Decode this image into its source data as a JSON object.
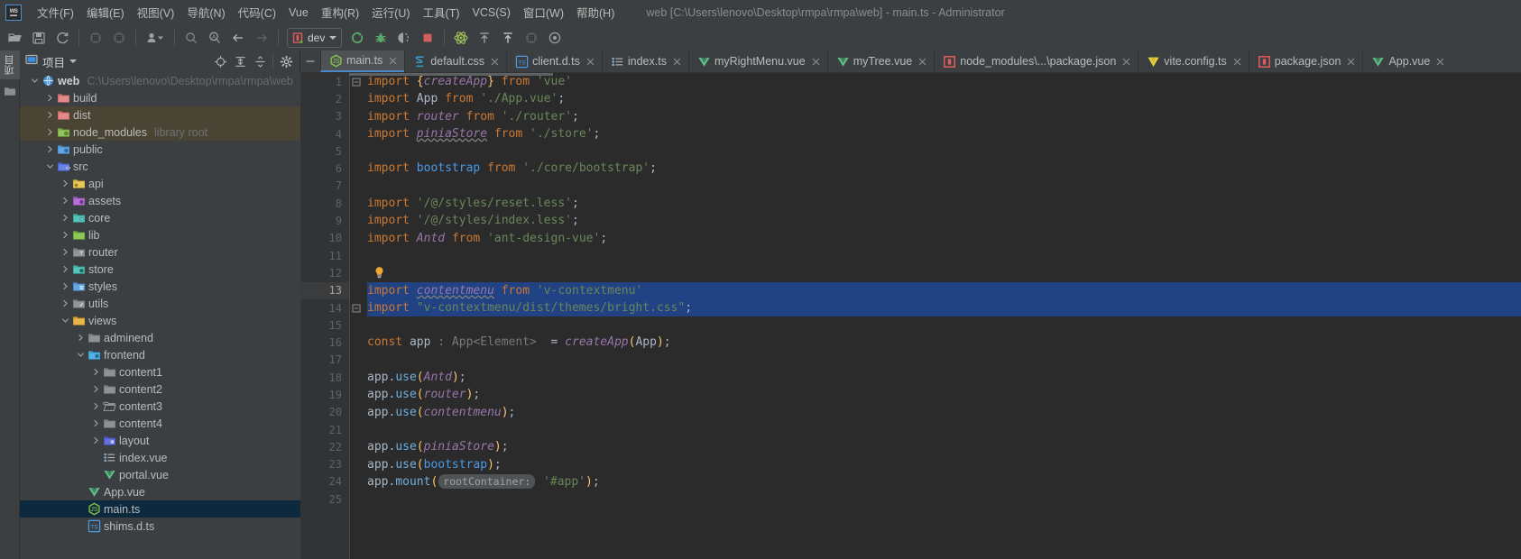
{
  "window": {
    "title": "web [C:\\Users\\lenovo\\Desktop\\rmpa\\rmpa\\web] - main.ts - Administrator",
    "logo_text": "WS"
  },
  "menubar": {
    "items": [
      {
        "label": "文件(F)",
        "name": "menu-file"
      },
      {
        "label": "编辑(E)",
        "name": "menu-edit"
      },
      {
        "label": "视图(V)",
        "name": "menu-view"
      },
      {
        "label": "导航(N)",
        "name": "menu-navigate"
      },
      {
        "label": "代码(C)",
        "name": "menu-code"
      },
      {
        "label": "Vue",
        "name": "menu-vue"
      },
      {
        "label": "重构(R)",
        "name": "menu-refactor"
      },
      {
        "label": "运行(U)",
        "name": "menu-run"
      },
      {
        "label": "工具(T)",
        "name": "menu-tools"
      },
      {
        "label": "VCS(S)",
        "name": "menu-vcs"
      },
      {
        "label": "窗口(W)",
        "name": "menu-window"
      },
      {
        "label": "帮助(H)",
        "name": "menu-help"
      }
    ]
  },
  "toolbar": {
    "run_config_label": "dev",
    "icons": [
      "open-folder-icon",
      "save-all-icon",
      "sync-refresh-icon",
      "separator",
      "grid-icon",
      "grid-icon-2",
      "separator",
      "user-dropdown-icon",
      "separator",
      "search-icon",
      "search-everywhere-icon",
      "back-arrow-icon",
      "forward-arrow-icon",
      "separator",
      "run-config-selector",
      "run-icon",
      "debug-icon",
      "coverage-icon",
      "stop-icon",
      "separator",
      "atom-icon",
      "update-project-icon",
      "commit-icon",
      "grid-icon-3",
      "settings-gear-icon"
    ]
  },
  "toolstrip": {
    "project_tab_label": "项目",
    "folder_icon": "folder-icon"
  },
  "project_panel": {
    "title": "项目",
    "header_buttons": [
      {
        "name": "locate-file-icon"
      },
      {
        "name": "expand-all-icon"
      },
      {
        "name": "collapse-all-icon"
      },
      {
        "name": "panel-settings-gear-icon"
      }
    ],
    "tree": [
      {
        "label": "web",
        "sub": "C:\\Users\\lenovo\\Desktop\\rmpa\\rmpa\\web",
        "indent": 0,
        "arrow": "down",
        "icon": "module-root-icon",
        "state": "normal",
        "bold": true
      },
      {
        "label": "build",
        "sub": "",
        "indent": 1,
        "arrow": "right",
        "icon": "folder-red-icon",
        "state": "normal"
      },
      {
        "label": "dist",
        "sub": "",
        "indent": 1,
        "arrow": "right",
        "icon": "folder-red-icon",
        "state": "hover"
      },
      {
        "label": "node_modules",
        "sub": "library root",
        "indent": 1,
        "arrow": "right",
        "icon": "folder-green-icon",
        "state": "hover"
      },
      {
        "label": "public",
        "sub": "",
        "indent": 1,
        "arrow": "right",
        "icon": "folder-blue-icon",
        "state": "normal"
      },
      {
        "label": "src",
        "sub": "",
        "indent": 1,
        "arrow": "down",
        "icon": "folder-source-icon",
        "state": "normal"
      },
      {
        "label": "api",
        "sub": "",
        "indent": 2,
        "arrow": "right",
        "icon": "folder-yellow-icon",
        "state": "normal"
      },
      {
        "label": "assets",
        "sub": "",
        "indent": 2,
        "arrow": "right",
        "icon": "folder-purple-icon",
        "state": "normal"
      },
      {
        "label": "core",
        "sub": "",
        "indent": 2,
        "arrow": "right",
        "icon": "folder-teal-icon",
        "state": "normal"
      },
      {
        "label": "lib",
        "sub": "",
        "indent": 2,
        "arrow": "right",
        "icon": "folder-lime-icon",
        "state": "normal"
      },
      {
        "label": "router",
        "sub": "",
        "indent": 2,
        "arrow": "right",
        "icon": "folder-grey-icon",
        "state": "normal"
      },
      {
        "label": "store",
        "sub": "",
        "indent": 2,
        "arrow": "right",
        "icon": "folder-teal2-icon",
        "state": "normal"
      },
      {
        "label": "styles",
        "sub": "",
        "indent": 2,
        "arrow": "right",
        "icon": "folder-blue2-icon",
        "state": "normal"
      },
      {
        "label": "utils",
        "sub": "",
        "indent": 2,
        "arrow": "right",
        "icon": "folder-grey2-icon",
        "state": "normal"
      },
      {
        "label": "views",
        "sub": "",
        "indent": 2,
        "arrow": "down",
        "icon": "folder-orange-icon",
        "state": "normal"
      },
      {
        "label": "adminend",
        "sub": "",
        "indent": 3,
        "arrow": "right",
        "icon": "folder-plain-icon",
        "state": "normal"
      },
      {
        "label": "frontend",
        "sub": "",
        "indent": 3,
        "arrow": "down",
        "icon": "folder-cyan-icon",
        "state": "normal"
      },
      {
        "label": "content1",
        "sub": "",
        "indent": 4,
        "arrow": "right",
        "icon": "folder-plain-icon",
        "state": "normal"
      },
      {
        "label": "content2",
        "sub": "",
        "indent": 4,
        "arrow": "right",
        "icon": "folder-plain-icon",
        "state": "normal"
      },
      {
        "label": "content3",
        "sub": "",
        "indent": 4,
        "arrow": "right",
        "icon": "folder-open-icon",
        "state": "normal"
      },
      {
        "label": "content4",
        "sub": "",
        "indent": 4,
        "arrow": "right",
        "icon": "folder-plain-icon",
        "state": "normal"
      },
      {
        "label": "layout",
        "sub": "",
        "indent": 4,
        "arrow": "right",
        "icon": "folder-indigo-icon",
        "state": "normal"
      },
      {
        "label": "index.vue",
        "sub": "",
        "indent": 4,
        "arrow": "none",
        "icon": "list-file-icon",
        "state": "normal"
      },
      {
        "label": "portal.vue",
        "sub": "",
        "indent": 4,
        "arrow": "none",
        "icon": "vue-file-icon",
        "state": "normal"
      },
      {
        "label": "App.vue",
        "sub": "",
        "indent": 3,
        "arrow": "none",
        "icon": "vue-file-icon",
        "state": "normal"
      },
      {
        "label": "main.ts",
        "sub": "",
        "indent": 3,
        "arrow": "none",
        "icon": "node-js-file-icon",
        "state": "selected"
      },
      {
        "label": "shims.d.ts",
        "sub": "",
        "indent": 3,
        "arrow": "none",
        "icon": "ts-file-icon",
        "state": "normal"
      }
    ]
  },
  "editor": {
    "tabs": [
      {
        "label": "main.ts",
        "icon": "node-js-file-icon",
        "active": true
      },
      {
        "label": "default.css",
        "icon": "css-file-icon",
        "active": false
      },
      {
        "label": "client.d.ts",
        "icon": "ts-file-icon",
        "active": false
      },
      {
        "label": "index.ts",
        "icon": "list-file-icon",
        "active": false
      },
      {
        "label": "myRightMenu.vue",
        "icon": "vue-file-icon",
        "active": false
      },
      {
        "label": "myTree.vue",
        "icon": "vue-file-icon",
        "active": false
      },
      {
        "label": "node_modules\\...\\package.json",
        "icon": "json-file-icon",
        "active": false
      },
      {
        "label": "vite.config.ts",
        "icon": "vite-file-icon",
        "active": false
      },
      {
        "label": "package.json",
        "icon": "json-file-icon",
        "active": false
      },
      {
        "label": "App.vue",
        "icon": "vue-file-icon",
        "active": false
      }
    ],
    "current_line": 13,
    "selected_lines": [
      13,
      14
    ],
    "lines": [
      {
        "n": 1,
        "fold": "collapse",
        "tokens": [
          {
            "t": "import ",
            "c": "kw"
          },
          {
            "t": "{",
            "c": "fn"
          },
          {
            "t": "createApp",
            "c": "ital"
          },
          {
            "t": "}",
            "c": "fn"
          },
          {
            "t": " ",
            "c": "pun"
          },
          {
            "t": "from",
            "c": "kw"
          },
          {
            "t": " ",
            "c": "pun"
          },
          {
            "t": "'vue'",
            "c": "str"
          }
        ]
      },
      {
        "n": 2,
        "fold": "",
        "tokens": [
          {
            "t": "import ",
            "c": "kw"
          },
          {
            "t": "App",
            "c": "cls"
          },
          {
            "t": " ",
            "c": "pun"
          },
          {
            "t": "from",
            "c": "kw"
          },
          {
            "t": " ",
            "c": "pun"
          },
          {
            "t": "'./App.vue'",
            "c": "str"
          },
          {
            "t": ";",
            "c": "pun"
          }
        ]
      },
      {
        "n": 3,
        "fold": "",
        "tokens": [
          {
            "t": "import ",
            "c": "kw"
          },
          {
            "t": "router",
            "c": "ital"
          },
          {
            "t": " ",
            "c": "pun"
          },
          {
            "t": "from",
            "c": "kw"
          },
          {
            "t": " ",
            "c": "pun"
          },
          {
            "t": "'./router'",
            "c": "str"
          },
          {
            "t": ";",
            "c": "pun"
          }
        ]
      },
      {
        "n": 4,
        "fold": "",
        "tokens": [
          {
            "t": "import ",
            "c": "kw"
          },
          {
            "t": "piniaStore",
            "c": "ital squig"
          },
          {
            "t": " ",
            "c": "pun"
          },
          {
            "t": "from",
            "c": "kw"
          },
          {
            "t": " ",
            "c": "pun"
          },
          {
            "t": "'./store'",
            "c": "str"
          },
          {
            "t": ";",
            "c": "pun"
          }
        ]
      },
      {
        "n": 5,
        "fold": "",
        "tokens": []
      },
      {
        "n": 6,
        "fold": "",
        "tokens": [
          {
            "t": "import ",
            "c": "kw"
          },
          {
            "t": "bootstrap",
            "c": "blue"
          },
          {
            "t": " ",
            "c": "pun"
          },
          {
            "t": "from",
            "c": "kw"
          },
          {
            "t": " ",
            "c": "pun"
          },
          {
            "t": "'./core/bootstrap'",
            "c": "str"
          },
          {
            "t": ";",
            "c": "pun"
          }
        ]
      },
      {
        "n": 7,
        "fold": "",
        "tokens": []
      },
      {
        "n": 8,
        "fold": "",
        "tokens": [
          {
            "t": "import ",
            "c": "kw"
          },
          {
            "t": "'/@/styles/reset.less'",
            "c": "str"
          },
          {
            "t": ";",
            "c": "pun"
          }
        ]
      },
      {
        "n": 9,
        "fold": "",
        "tokens": [
          {
            "t": "import ",
            "c": "kw"
          },
          {
            "t": "'/@/styles/index.less'",
            "c": "str"
          },
          {
            "t": ";",
            "c": "pun"
          }
        ]
      },
      {
        "n": 10,
        "fold": "",
        "tokens": [
          {
            "t": "import ",
            "c": "kw"
          },
          {
            "t": "Antd",
            "c": "ital"
          },
          {
            "t": " ",
            "c": "pun"
          },
          {
            "t": "from",
            "c": "kw"
          },
          {
            "t": " ",
            "c": "pun"
          },
          {
            "t": "'ant-design-vue'",
            "c": "str"
          },
          {
            "t": ";",
            "c": "pun"
          }
        ]
      },
      {
        "n": 11,
        "fold": "",
        "tokens": []
      },
      {
        "n": 12,
        "fold": "",
        "tokens": [],
        "bulb": true
      },
      {
        "n": 13,
        "fold": "",
        "selected": true,
        "tokens": [
          {
            "t": "import ",
            "c": "kw"
          },
          {
            "t": "contentmenu",
            "c": "ital squig"
          },
          {
            "t": " ",
            "c": "pun"
          },
          {
            "t": "from",
            "c": "kw"
          },
          {
            "t": " ",
            "c": "pun"
          },
          {
            "t": "'v-contextmenu'",
            "c": "str"
          }
        ]
      },
      {
        "n": 14,
        "fold": "collapse",
        "selected": true,
        "tokens": [
          {
            "t": "import ",
            "c": "kw"
          },
          {
            "t": "\"v-contextmenu/dist/themes/bright.css\"",
            "c": "str"
          },
          {
            "t": ";",
            "c": "pun"
          }
        ]
      },
      {
        "n": 15,
        "fold": "",
        "tokens": []
      },
      {
        "n": 16,
        "fold": "",
        "tokens": [
          {
            "t": "const ",
            "c": "kw"
          },
          {
            "t": "app",
            "c": "cls"
          },
          {
            "t": " : App<Element>  ",
            "c": "hint"
          },
          {
            "t": "= ",
            "c": "pun"
          },
          {
            "t": "createApp",
            "c": "ital"
          },
          {
            "t": "(",
            "c": "fn"
          },
          {
            "t": "App",
            "c": "cls"
          },
          {
            "t": ")",
            "c": "fn"
          },
          {
            "t": ";",
            "c": "pun"
          }
        ]
      },
      {
        "n": 17,
        "fold": "",
        "tokens": []
      },
      {
        "n": 18,
        "fold": "",
        "tokens": [
          {
            "t": "app",
            "c": "cls"
          },
          {
            "t": ".",
            "c": "pun"
          },
          {
            "t": "use",
            "c": "meth"
          },
          {
            "t": "(",
            "c": "fn"
          },
          {
            "t": "Antd",
            "c": "ital"
          },
          {
            "t": ")",
            "c": "fn"
          },
          {
            "t": ";",
            "c": "pun"
          }
        ]
      },
      {
        "n": 19,
        "fold": "",
        "tokens": [
          {
            "t": "app",
            "c": "cls"
          },
          {
            "t": ".",
            "c": "pun"
          },
          {
            "t": "use",
            "c": "meth"
          },
          {
            "t": "(",
            "c": "fn"
          },
          {
            "t": "router",
            "c": "ital"
          },
          {
            "t": ")",
            "c": "fn"
          },
          {
            "t": ";",
            "c": "pun"
          }
        ]
      },
      {
        "n": 20,
        "fold": "",
        "tokens": [
          {
            "t": "app",
            "c": "cls"
          },
          {
            "t": ".",
            "c": "pun"
          },
          {
            "t": "use",
            "c": "meth"
          },
          {
            "t": "(",
            "c": "fn"
          },
          {
            "t": "contentmenu",
            "c": "ital"
          },
          {
            "t": ")",
            "c": "fn"
          },
          {
            "t": ";",
            "c": "pun"
          }
        ]
      },
      {
        "n": 21,
        "fold": "",
        "tokens": []
      },
      {
        "n": 22,
        "fold": "",
        "tokens": [
          {
            "t": "app",
            "c": "cls"
          },
          {
            "t": ".",
            "c": "pun"
          },
          {
            "t": "use",
            "c": "meth"
          },
          {
            "t": "(",
            "c": "fn"
          },
          {
            "t": "piniaStore",
            "c": "ital"
          },
          {
            "t": ")",
            "c": "fn"
          },
          {
            "t": ";",
            "c": "pun"
          }
        ]
      },
      {
        "n": 23,
        "fold": "",
        "tokens": [
          {
            "t": "app",
            "c": "cls"
          },
          {
            "t": ".",
            "c": "pun"
          },
          {
            "t": "use",
            "c": "meth"
          },
          {
            "t": "(",
            "c": "fn"
          },
          {
            "t": "bootstrap",
            "c": "blue"
          },
          {
            "t": ")",
            "c": "fn"
          },
          {
            "t": ";",
            "c": "pun"
          }
        ]
      },
      {
        "n": 24,
        "fold": "",
        "tokens": [
          {
            "t": "app",
            "c": "cls"
          },
          {
            "t": ".",
            "c": "pun"
          },
          {
            "t": "mount",
            "c": "meth"
          },
          {
            "t": "(",
            "c": "fn"
          },
          {
            "t": "rootContainer:",
            "c": "chip"
          },
          {
            "t": " ",
            "c": "pun"
          },
          {
            "t": "'#app'",
            "c": "str"
          },
          {
            "t": ")",
            "c": "fn"
          },
          {
            "t": ";",
            "c": "pun"
          }
        ]
      },
      {
        "n": 25,
        "fold": "",
        "tokens": []
      }
    ]
  },
  "colors": {
    "chrome_bg": "#3c3f41",
    "editor_bg": "#2b2b2b",
    "gutter_bg": "#313335",
    "selection": "#214283",
    "tree_selected": "#0d293e",
    "tree_hover": "#4a4434",
    "accent_tab": "#4a88c7",
    "keyword": "#cc7832",
    "string": "#6a8759",
    "identifier_italic": "#9876aa",
    "function": "#ffc66d",
    "default_text": "#a9b7c6"
  }
}
